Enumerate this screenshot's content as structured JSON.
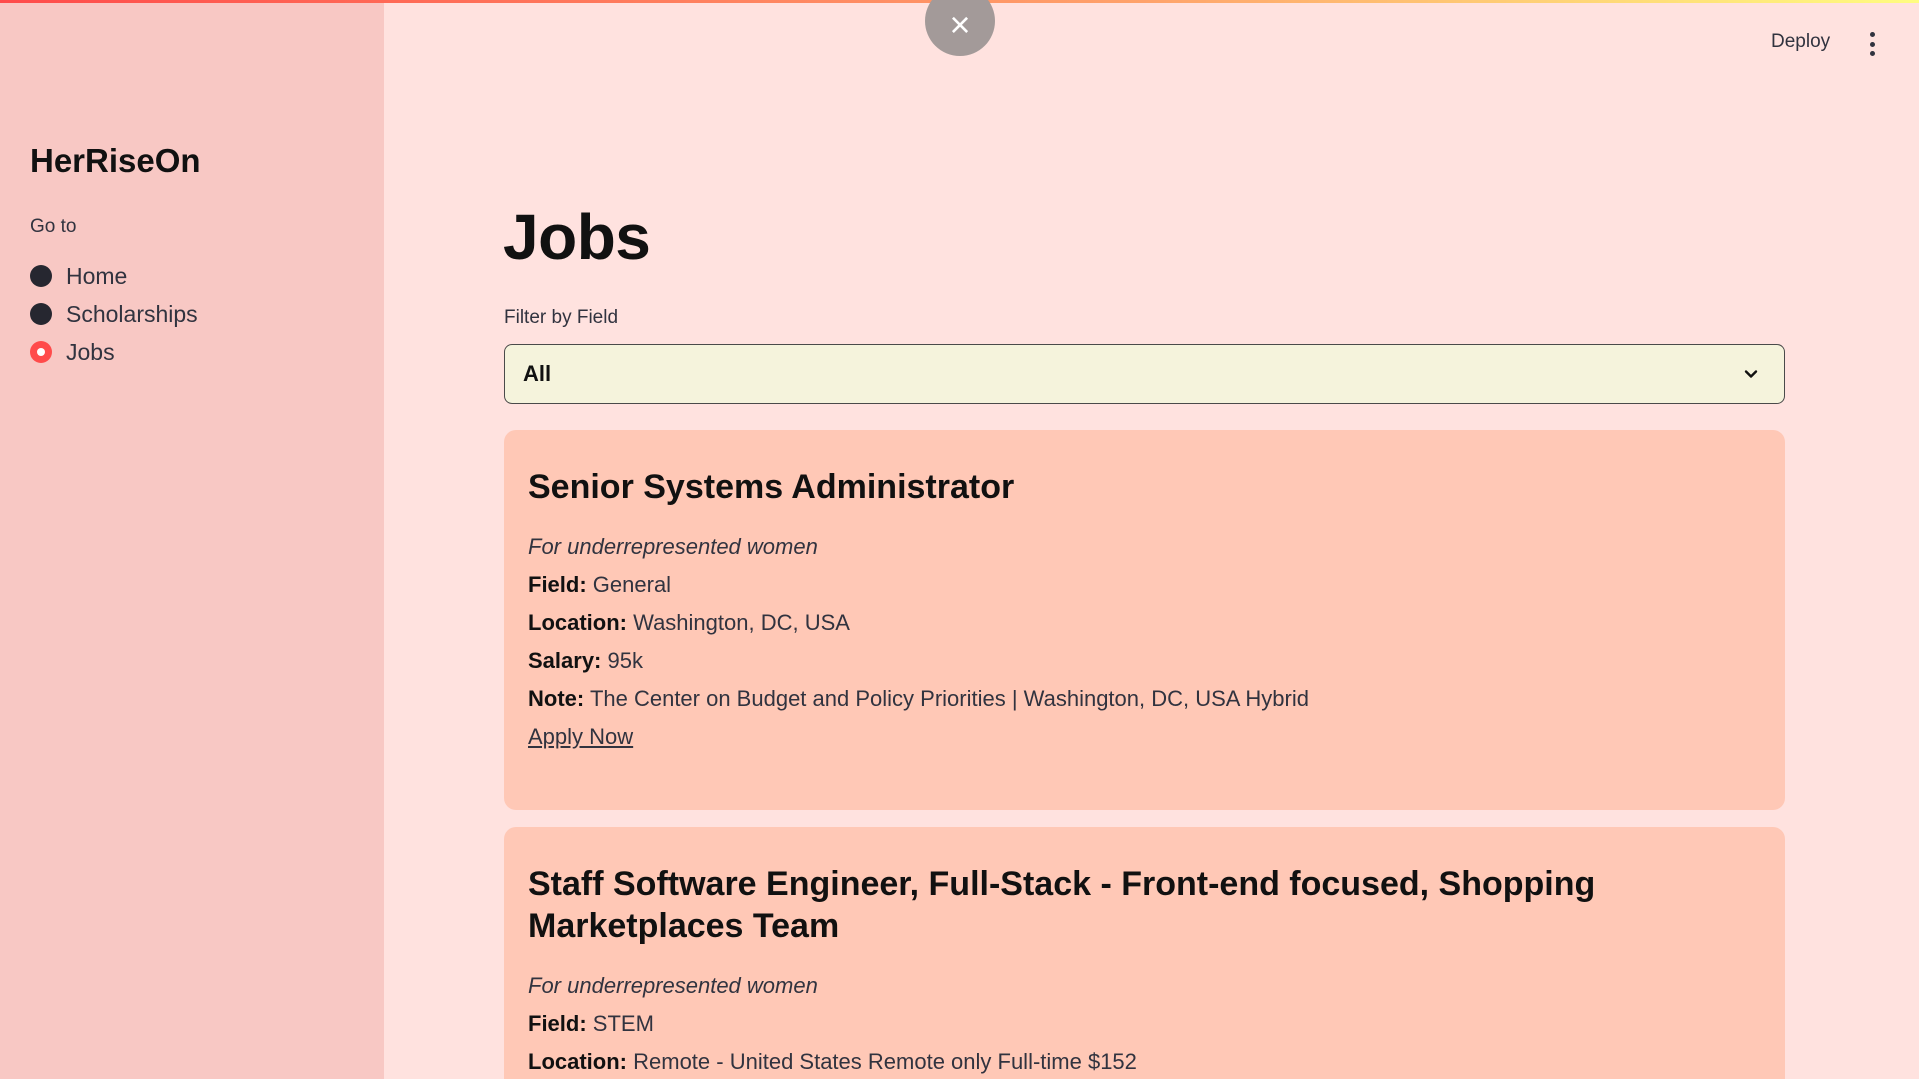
{
  "sidebar": {
    "app_title": "HerRiseOn",
    "goto_label": "Go to",
    "items": [
      {
        "label": "Home",
        "selected": false
      },
      {
        "label": "Scholarships",
        "selected": false
      },
      {
        "label": "Jobs",
        "selected": true
      }
    ]
  },
  "header": {
    "close_icon": "×",
    "deploy_label": "Deploy"
  },
  "main": {
    "title": "Jobs",
    "filter": {
      "label": "Filter by Field",
      "value": "All"
    },
    "jobs": [
      {
        "title": "Senior Systems Administrator",
        "subtitle": "For underrepresented women",
        "field_label": "Field:",
        "field": "General",
        "location_label": "Location:",
        "location": "Washington, DC, USA",
        "salary_label": "Salary:",
        "salary": "95k",
        "note_label": "Note:",
        "note": "The Center on Budget and Policy Priorities | Washington, DC, USA Hybrid",
        "apply_label": "Apply Now"
      },
      {
        "title": "Staff Software Engineer, Full-Stack - Front-end focused, Shopping Marketplaces Team",
        "subtitle": "For underrepresented women",
        "field_label": "Field:",
        "field": "STEM",
        "location_label": "Location:",
        "location": "Remote - United States Remote only Full-time $152"
      }
    ]
  },
  "colors": {
    "accent": "#ff4b4b",
    "sidebar_bg": "#f8c8c4",
    "main_bg": "#ffe2df",
    "card_bg": "#ffc8b6",
    "select_bg": "#f5f3dc"
  }
}
